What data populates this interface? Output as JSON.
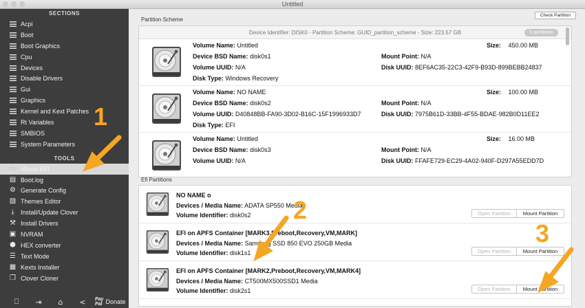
{
  "window": {
    "title": "Untitled"
  },
  "sidebar": {
    "sections_title": "SECTIONS",
    "sections": [
      "Acpi",
      "Boot",
      "Boot Graphics",
      "Cpu",
      "Devices",
      "Disable Drivers",
      "Gui",
      "Graphics",
      "Kernel and Kext Patches",
      "Rt Variables",
      "SMBIOS",
      "System Parameters"
    ],
    "tools_title": "TOOLS",
    "tools": [
      {
        "label": "Mount EFI",
        "icon": "drive-icon",
        "selected": true
      },
      {
        "label": "Boot.log",
        "icon": "document-icon"
      },
      {
        "label": "Generate Config",
        "icon": "settings-icon"
      },
      {
        "label": "Themes Editor",
        "icon": "image-icon"
      },
      {
        "label": "Install/Update Clover",
        "icon": "download-icon"
      },
      {
        "label": "Install Drivers",
        "icon": "wrench-icon"
      },
      {
        "label": "NVRAM",
        "icon": "chip-icon"
      },
      {
        "label": "HEX converter",
        "icon": "hex-icon"
      },
      {
        "label": "Text Mode",
        "icon": "text-icon"
      },
      {
        "label": "Kexts Installer",
        "icon": "package-icon"
      },
      {
        "label": "Clover Cloner",
        "icon": "copy-icon"
      }
    ],
    "bottom": {
      "donate_label": "Donate",
      "paypal_line1": "Pay",
      "paypal_line2": "Pal"
    }
  },
  "partition_scheme": {
    "group_label": "Partition Scheme",
    "check_button": "Check Partition",
    "device_header": "Device Identifier: DISK0 - Partition Scheme: GUID_partition_scheme - Size: 223.57 GB",
    "badge": "5 partitions",
    "volumes": [
      {
        "volume_name": "Untitled",
        "bsd_name": "disk0s1",
        "volume_uuid": "N/A",
        "disk_type": "Windows Recovery",
        "size": "450.00 MB",
        "mount_point": "N/A",
        "disk_uuid": "8EF6AC35-22C3-42F9-B93D-899BEBB24837"
      },
      {
        "volume_name": "NO NAME",
        "bsd_name": "disk0s2",
        "volume_uuid": "D40848BB-FA90-3D02-B16C-15F1996933D7",
        "disk_type": "EFI",
        "size": "100.00 MB",
        "mount_point": "N/A",
        "disk_uuid": "7975B61D-33BB-4F55-BDAE-982B0D11EE2"
      },
      {
        "volume_name": "Untitled",
        "bsd_name": "disk0s3",
        "volume_uuid": "N/A",
        "disk_type": "",
        "size": "16.00 MB",
        "mount_point": "N/A",
        "disk_uuid": "FFAFE729-EC29-4A02-940F-D297A55EDD7D"
      }
    ],
    "labels": {
      "volume_name": "Volume Name:",
      "bsd_name": "Device BSD Name:",
      "volume_uuid": "Volume UUID:",
      "disk_type": "Disk Type:",
      "size": "Size:",
      "mount_point": "Mount Point:",
      "disk_uuid": "Disk UUID:"
    }
  },
  "efi_partitions": {
    "group_label": "Efi Partitions",
    "labels": {
      "media": "Devices / Media Name:",
      "volume_id": "Volume Identifier:"
    },
    "open_label": "Open Partition",
    "mount_label": "Mount Partition",
    "items": [
      {
        "title": "NO NAME o",
        "media": "ADATA SP550 Media",
        "volume_id": "disk0s2"
      },
      {
        "title": "EFI on APFS Container [MARK3,Preboot,Recovery,VM,MARK]",
        "media": "Samsung SSD 850 EVO 250GB Media",
        "volume_id": "disk1s1"
      },
      {
        "title": "EFI on APFS Container [MARK2,Preboot,Recovery,VM,MARK4]",
        "media": "CT500MX500SSD1 Media",
        "volume_id": "disk2s1"
      }
    ]
  },
  "annotations": [
    "1",
    "2",
    "3"
  ],
  "colors": {
    "sidebar_bg": "#3d3d3d",
    "accent_arrow": "#f5a623",
    "selected_item": "#d9d9d9"
  }
}
